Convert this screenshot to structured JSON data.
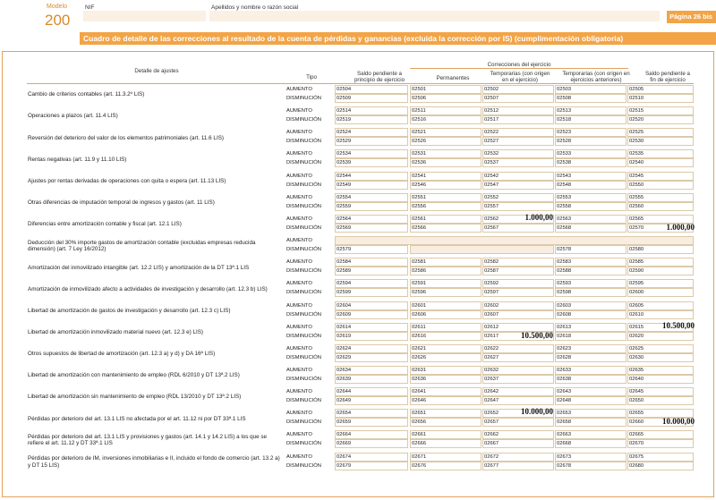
{
  "header": {
    "modelo_label": "Modelo",
    "modelo_number": "200",
    "nif_label": "NIF",
    "name_label": "Apellidos y nombre o razón social",
    "page_label": "Página 26 bis"
  },
  "title": "Cuadro de detalle de las correcciones al resultado de la cuenta de pérdidas y ganancias (excluida la corrección por IS) (cumplimentación obligatoria)",
  "columns": {
    "detalle": "Detalle de ajustes",
    "tipo": "Tipo",
    "saldo_pend": "Saldo pendiente a principio de ejercicio",
    "correcciones": "Correcciones del ejercicio",
    "permanentes": "Permanentes",
    "temporarias": "Temporarias (con origen en el ejercicio)",
    "temporarias_ant": "Temporarias (con origen en ejercicios anteriores)",
    "saldo_fin": "Saldo pendiente a fin de ejercicio"
  },
  "tipo_aumento": "AUMENTO",
  "tipo_disminucion": "DISMINUCIÓN",
  "rows": [
    {
      "label": "Cambio de criterios contables (art. 11.3.2º LIS)",
      "aum": [
        "02504",
        "02501",
        "02502",
        "02503",
        "02505"
      ],
      "dis": [
        "02509",
        "02506",
        "02507",
        "02508",
        "02510"
      ]
    },
    {
      "label": "Operaciones a plazos (art. 11.4 LIS)",
      "aum": [
        "02514",
        "02511",
        "02512",
        "02513",
        "02515"
      ],
      "dis": [
        "02519",
        "02516",
        "02517",
        "02518",
        "02520"
      ]
    },
    {
      "label": "Reversión del deterioro del valor de los elementos patrimoniales (art. 11.6 LIS)",
      "aum": [
        "02524",
        "02521",
        "02522",
        "02523",
        "02525"
      ],
      "dis": [
        "02529",
        "02526",
        "02527",
        "02528",
        "02530"
      ]
    },
    {
      "label": "Rentas negativas (art. 11.9 y 11.10 LIS)",
      "aum": [
        "02534",
        "02531",
        "02532",
        "02533",
        "02535"
      ],
      "dis": [
        "02539",
        "02536",
        "02537",
        "02538",
        "02540"
      ]
    },
    {
      "label": "Ajustes por rentas derivadas de operaciones con quita o espera (art. 11.13 LIS)",
      "aum": [
        "02544",
        "02541",
        "02542",
        "02543",
        "02545"
      ],
      "dis": [
        "02549",
        "02546",
        "02547",
        "02548",
        "02550"
      ]
    },
    {
      "label": "Otras diferencias de imputación temporal de ingresos y gastos (art. 11 LIS)",
      "aum": [
        "02554",
        "02551",
        "02552",
        "02553",
        "02555"
      ],
      "dis": [
        "02559",
        "02556",
        "02557",
        "02558",
        "02560"
      ]
    },
    {
      "label": "Diferencias entre amortización contable y fiscal (art. 12.1 LIS)",
      "aum": [
        "02564",
        "02561",
        "02562",
        "02563",
        "02565"
      ],
      "dis": [
        "02569",
        "02566",
        "02567",
        "02568",
        "02570"
      ],
      "aum_val_temp": "1.000,00",
      "dis_val_fin": "1.000,00"
    },
    {
      "label": "Deducción del 30% importe gastos de amortización contable (excluidas empresas reducida dimensión) (art. 7 Ley 16/2012)",
      "aum": [
        "",
        "",
        "",
        "",
        ""
      ],
      "dis": [
        "02579",
        "",
        "",
        "02578",
        "02580"
      ],
      "special": true
    },
    {
      "label": "Amortización del inmovilizado intangible (art. 12.2 LIS) y amortización de la DT 13ª.1 LIS",
      "aum": [
        "02584",
        "02581",
        "02582",
        "02583",
        "02585"
      ],
      "dis": [
        "02589",
        "02586",
        "02587",
        "02588",
        "02590"
      ]
    },
    {
      "label": "Amortización de inmovilizado afecto a actividades de investigación y desarrollo (art. 12.3 b) LIS)",
      "aum": [
        "02594",
        "02591",
        "02592",
        "02593",
        "02595"
      ],
      "dis": [
        "02599",
        "02596",
        "02597",
        "02598",
        "02600"
      ]
    },
    {
      "label": "Libertad de amortización de gastos de investigación y desarrollo (art. 12.3 c) LIS)",
      "aum": [
        "02604",
        "02601",
        "02602",
        "02603",
        "02605"
      ],
      "dis": [
        "02609",
        "02606",
        "02607",
        "02608",
        "02610"
      ]
    },
    {
      "label": "Libertad de amortización inmovilizado material nuevo (art. 12.3 e) LIS)",
      "aum": [
        "02614",
        "02611",
        "02612",
        "02613",
        "02615"
      ],
      "dis": [
        "02619",
        "02616",
        "02617",
        "02618",
        "02620"
      ],
      "dis_val_temp": "10.500,00",
      "aum_val_fin": "10.500,00"
    },
    {
      "label": "Otros supuestos de libertad de amortización (art. 12.3 a) y d) y DA 16ª LIS)",
      "aum": [
        "02624",
        "02621",
        "02622",
        "02623",
        "02625"
      ],
      "dis": [
        "02629",
        "02626",
        "02627",
        "02628",
        "02630"
      ]
    },
    {
      "label": "Libertad de amortización con mantenimiento de empleo (RDL 6/2010 y DT 13ª.2 LIS)",
      "aum": [
        "02634",
        "02631",
        "02632",
        "02633",
        "02635"
      ],
      "dis": [
        "02639",
        "02636",
        "02637",
        "02638",
        "02640"
      ]
    },
    {
      "label": "Libertad de amortización sin mantenimiento de empleo (RDL 13/2010 y DT 13ª.2 LIS)",
      "aum": [
        "02644",
        "02641",
        "02642",
        "02643",
        "02645"
      ],
      "dis": [
        "02649",
        "02646",
        "02647",
        "02648",
        "02650"
      ]
    },
    {
      "label": "Pérdidas por deterioro del art. 13.1 LIS no afectada por el art. 11.12 ni por DT 33ª.1 LIS",
      "aum": [
        "02654",
        "02651",
        "02652",
        "02653",
        "02655"
      ],
      "dis": [
        "02659",
        "02656",
        "02657",
        "02658",
        "02660"
      ],
      "aum_val_temp": "10.000,00",
      "dis_val_fin": "10.000,00"
    },
    {
      "label": "Pérdidas por deterioro del art. 13.1 LIS y provisiones y gastos (art. 14.1 y 14.2 LIS) a los que se refiere el art. 11.12 y DT 33ª.1 LIS",
      "aum": [
        "02664",
        "02661",
        "02662",
        "02663",
        "02665"
      ],
      "dis": [
        "02669",
        "02666",
        "02667",
        "02668",
        "02670"
      ]
    },
    {
      "label": "Pérdidas por deterioro de IM, inversiones inmobiliarias e II, incluido el fondo de comercio (art. 13.2 a) y DT 15 LIS)",
      "aum": [
        "02674",
        "02671",
        "02672",
        "02673",
        "02675"
      ],
      "dis": [
        "02679",
        "02676",
        "02677",
        "02678",
        "02680"
      ]
    }
  ]
}
